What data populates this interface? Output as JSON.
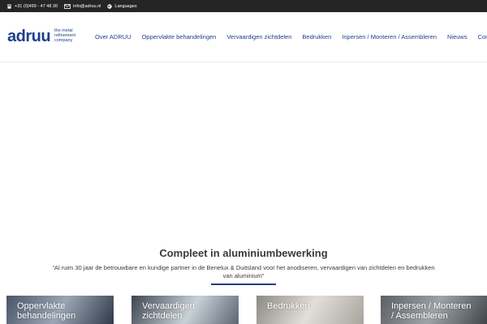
{
  "topbar": {
    "phone": "+31 (0)499 - 47 48 30",
    "email": "info@adruu.nl",
    "languages": "Languages"
  },
  "logo": {
    "word": "adruu",
    "tagline": [
      "the metal",
      "refinement",
      "company"
    ]
  },
  "nav": {
    "items": [
      "Over ADRUU",
      "Oppervlakte behandelingen",
      "Vervaardigen zichtdelen",
      "Bedrukken",
      "Inpersen / Monteren / Assembleren",
      "Nieuws",
      "Contact"
    ]
  },
  "intro": {
    "title": "Compleet in aluminiumbewerking",
    "quote": "“Al ruim 30 jaar de betrouwbare en kundige partner in de Benelux & Duitsland voor het anodiseren, vervaardigen van zichtdelen en bedrukken van aluminium”"
  },
  "cards": [
    {
      "line1": "Oppervlakte",
      "line2": "behandelingen"
    },
    {
      "line1": "Vervaardigen",
      "line2": "zichtdelen"
    },
    {
      "line1": "Bedrukken",
      "line2": ""
    },
    {
      "line1": "Inpersen / Monteren",
      "line2": "/ Assembleren"
    }
  ],
  "colors": {
    "brand": "#1d3f8a",
    "topbar": "#252525"
  }
}
